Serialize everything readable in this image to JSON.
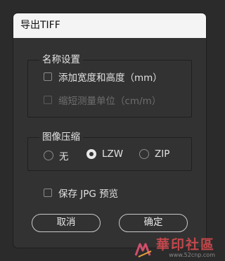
{
  "dialog": {
    "title": "导出TIFF",
    "naming": {
      "legend": "名称设置",
      "add_dims": "添加宽度和高度（mm）",
      "shorten_unit": "缩短测量单位（cm/m）"
    },
    "compression": {
      "legend": "图像压缩",
      "options": [
        "无",
        "LZW",
        "ZIP"
      ],
      "selected": "LZW"
    },
    "save_jpg_preview": "保存 JPG 预览",
    "buttons": {
      "cancel": "取消",
      "ok": "确定"
    }
  },
  "watermark": {
    "text": "華印社區",
    "url": "www.52cnp.com"
  }
}
